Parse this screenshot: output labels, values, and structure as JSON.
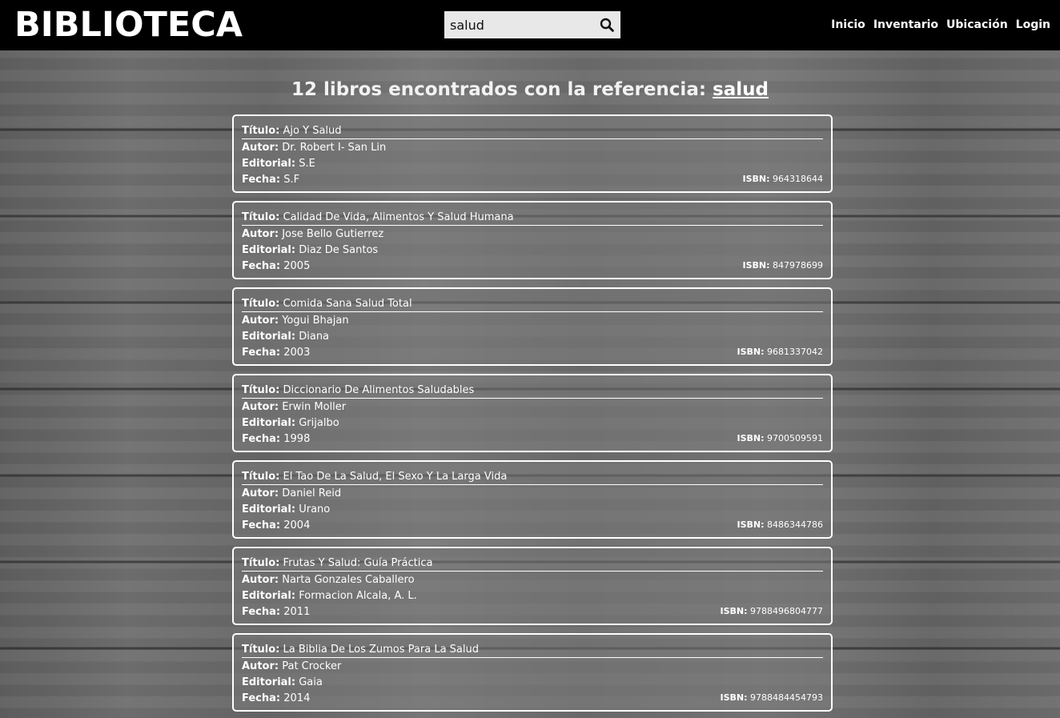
{
  "header": {
    "brand": "BIBLIOTECA",
    "search_value": "salud",
    "nav": [
      "Inicio",
      "Inventario",
      "Ubicación",
      "Login"
    ]
  },
  "results": {
    "heading_prefix": "12 libros encontrados con la referencia: ",
    "term": "salud"
  },
  "labels": {
    "titulo": "Título:",
    "autor": "Autor:",
    "editorial": "Editorial:",
    "fecha": "Fecha:",
    "isbn": "ISBN:"
  },
  "books": [
    {
      "titulo": "Ajo Y Salud",
      "autor": "Dr. Robert I- San Lin",
      "editorial": "S.E",
      "fecha": "S.F",
      "isbn": "964318644"
    },
    {
      "titulo": "Calidad De Vida, Alimentos Y Salud Humana",
      "autor": "Jose Bello Gutierrez",
      "editorial": "Diaz De Santos",
      "fecha": "2005",
      "isbn": "847978699"
    },
    {
      "titulo": "Comida Sana Salud Total",
      "autor": "Yogui Bhajan",
      "editorial": "Diana",
      "fecha": "2003",
      "isbn": "9681337042"
    },
    {
      "titulo": "Diccionario De Alimentos Saludables",
      "autor": "Erwin Moller",
      "editorial": "Grijalbo",
      "fecha": "1998",
      "isbn": "9700509591"
    },
    {
      "titulo": "El Tao De La Salud, El Sexo Y La Larga Vida",
      "autor": "Daniel Reid",
      "editorial": "Urano",
      "fecha": "2004",
      "isbn": "8486344786"
    },
    {
      "titulo": "Frutas Y Salud: Guía Práctica",
      "autor": "Narta Gonzales Caballero",
      "editorial": "Formacion Alcala, A. L.",
      "fecha": "2011",
      "isbn": "9788496804777"
    },
    {
      "titulo": "La Biblia De Los Zumos Para La Salud",
      "autor": "Pat Crocker",
      "editorial": "Gaia",
      "fecha": "2014",
      "isbn": "9788484454793"
    }
  ]
}
